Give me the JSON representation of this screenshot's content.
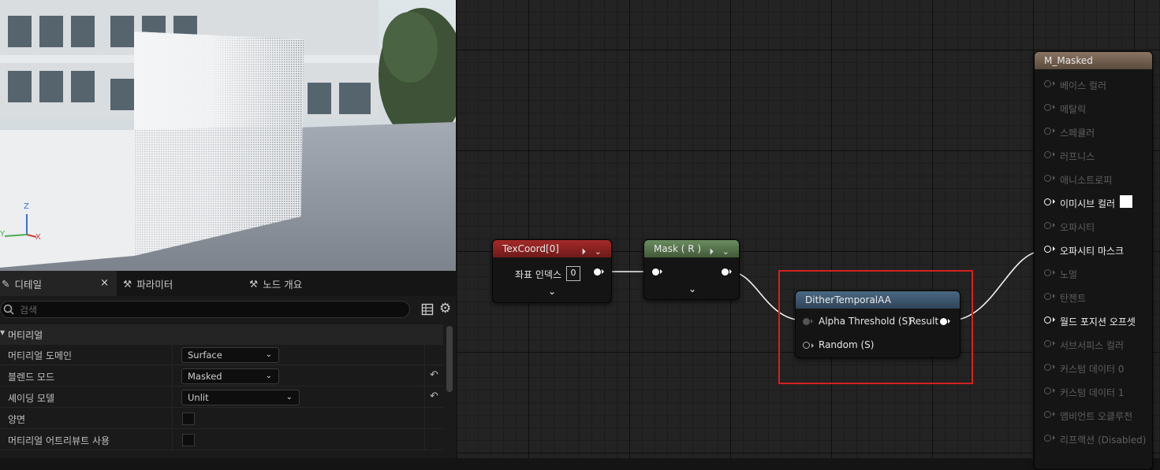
{
  "viewport": {
    "axes": {
      "z": "Z",
      "x": "X",
      "y": "Y"
    }
  },
  "details": {
    "tabs": [
      {
        "label": "디테일",
        "icon": "details-icon",
        "active": true
      },
      {
        "label": "파라미터",
        "icon": "parameter-icon"
      },
      {
        "label": "노드 개요",
        "icon": "node-overview-icon"
      }
    ],
    "close_glyph": "×",
    "search_placeholder": "검색",
    "section": "머티리얼",
    "rows": [
      {
        "label": "머티리얼 도메인",
        "value": "Surface"
      },
      {
        "label": "블렌드 모드",
        "value": "Masked"
      },
      {
        "label": "셰이딩 모델",
        "value": "Unlit"
      },
      {
        "label": "양면",
        "checked": false
      },
      {
        "label": "머티리얼 어트리뷰트 사용",
        "checked": false
      }
    ]
  },
  "graph": {
    "texcoord": {
      "title": "TexCoord[0]",
      "pin_label": "좌표 인덱스",
      "pin_value": "0",
      "color": "#8a1e1e"
    },
    "mask": {
      "title": "Mask ( R )",
      "color": "#4e6a44"
    },
    "dither": {
      "title": "DitherTemporalAA",
      "inputs": [
        "Alpha Threshold (S)",
        "Random (S)"
      ],
      "output": "Result",
      "color": "#3e5770"
    },
    "material": {
      "title": "M_Masked",
      "color": "#6e5a4a",
      "pins": [
        {
          "label": "베이스 컬러",
          "active": false
        },
        {
          "label": "메탈릭",
          "active": false
        },
        {
          "label": "스페큘러",
          "active": false
        },
        {
          "label": "러프니스",
          "active": false
        },
        {
          "label": "애니소트로피",
          "active": false
        },
        {
          "label": "이미시브 컬러",
          "active": true,
          "swatch": "#ffffff"
        },
        {
          "label": "오파시티",
          "active": false
        },
        {
          "label": "오파시티 마스크",
          "active": true
        },
        {
          "label": "노멀",
          "active": false
        },
        {
          "label": "탄젠트",
          "active": false
        },
        {
          "label": "월드 포지션 오프셋",
          "active": true
        },
        {
          "label": "서브서피스 컬러",
          "active": false
        },
        {
          "label": "커스텀 데이터 0",
          "active": false
        },
        {
          "label": "커스텀 데이터 1",
          "active": false
        },
        {
          "label": "앰비언트 오클루전",
          "active": false
        },
        {
          "label": "리프랙션 (Disabled)",
          "active": false
        }
      ]
    }
  }
}
